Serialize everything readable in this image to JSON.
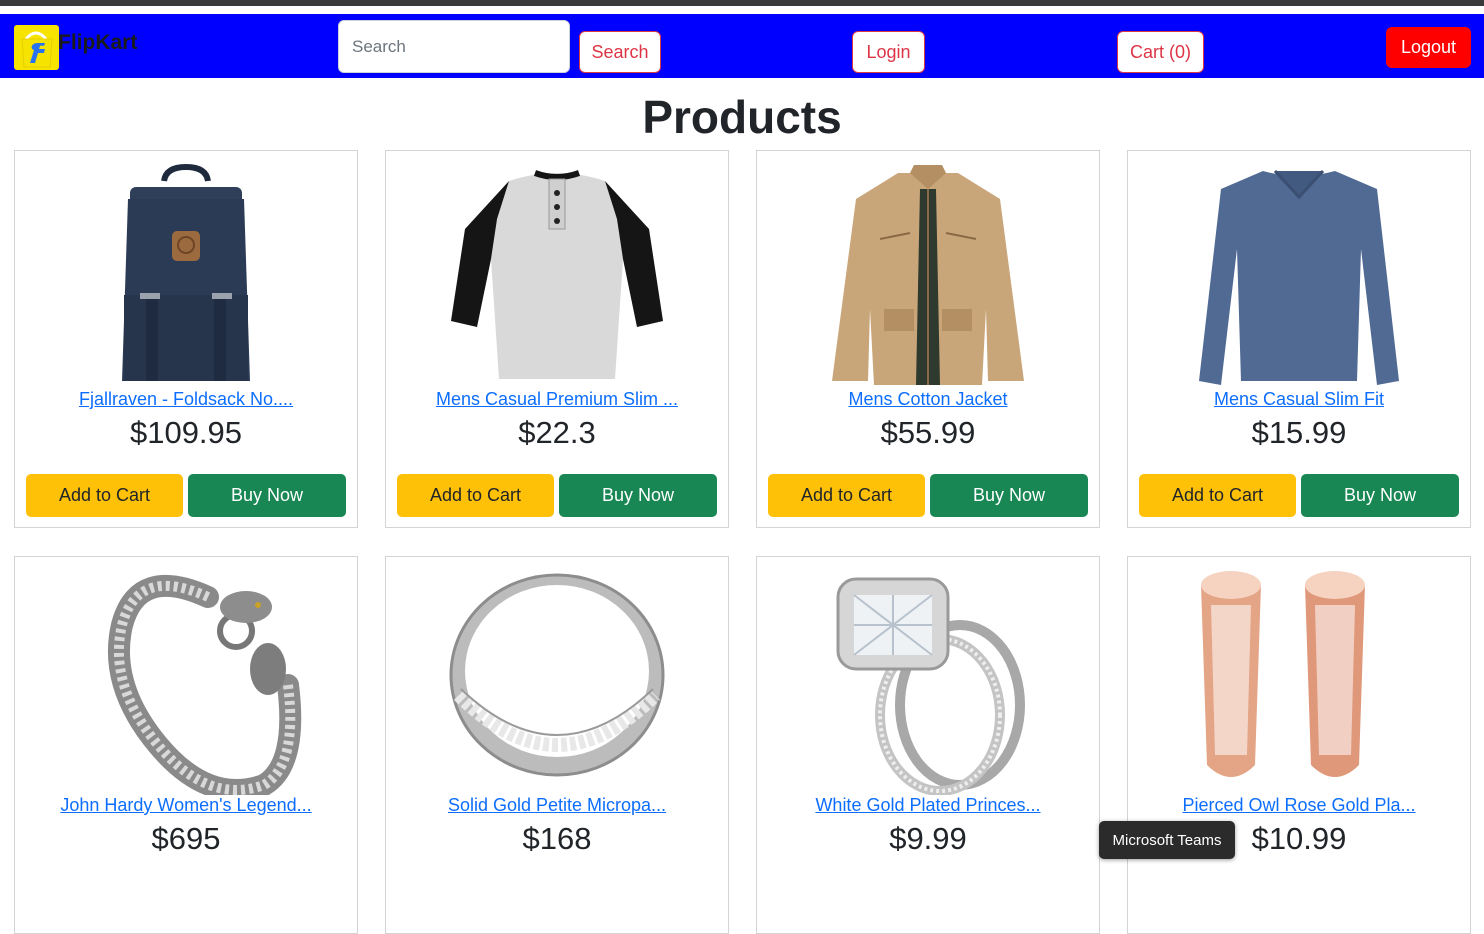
{
  "navbar": {
    "brand": "FlipKart",
    "search_placeholder": "Search",
    "search_label": "Search",
    "login_label": "Login",
    "cart_label": "Cart (0)",
    "logout_label": "Logout",
    "colors": {
      "background": "#0000ff",
      "logout": "#ff0000",
      "outline": "#dc3545"
    }
  },
  "page": {
    "title": "Products"
  },
  "products": [
    {
      "title": "Fjallraven - Foldsack No....",
      "price": "$109.95",
      "add_label": "Add to Cart",
      "buy_label": "Buy Now",
      "image": "backpack"
    },
    {
      "title": "Mens Casual Premium Slim ...",
      "price": "$22.3",
      "add_label": "Add to Cart",
      "buy_label": "Buy Now",
      "image": "raglan-shirt"
    },
    {
      "title": "Mens Cotton Jacket",
      "price": "$55.99",
      "add_label": "Add to Cart",
      "buy_label": "Buy Now",
      "image": "jacket"
    },
    {
      "title": "Mens Casual Slim Fit",
      "price": "$15.99",
      "add_label": "Add to Cart",
      "buy_label": "Buy Now",
      "image": "long-sleeve-shirt"
    },
    {
      "title": "John Hardy Women's Legend...",
      "price": "$695",
      "image": "dragon-bracelet"
    },
    {
      "title": "Solid Gold Petite Micropa...",
      "price": "$168",
      "image": "silver-band-ring"
    },
    {
      "title": "White Gold Plated Princes...",
      "price": "$9.99",
      "image": "diamond-ring-set"
    },
    {
      "title": "Pierced Owl Rose Gold Pla...",
      "price": "$10.99",
      "image": "rose-gold-tunnels"
    }
  ],
  "colors": {
    "add_to_cart": "#ffc107",
    "buy_now": "#198754",
    "link": "#0d6efd"
  },
  "tooltip": {
    "text": "Microsoft Teams"
  }
}
